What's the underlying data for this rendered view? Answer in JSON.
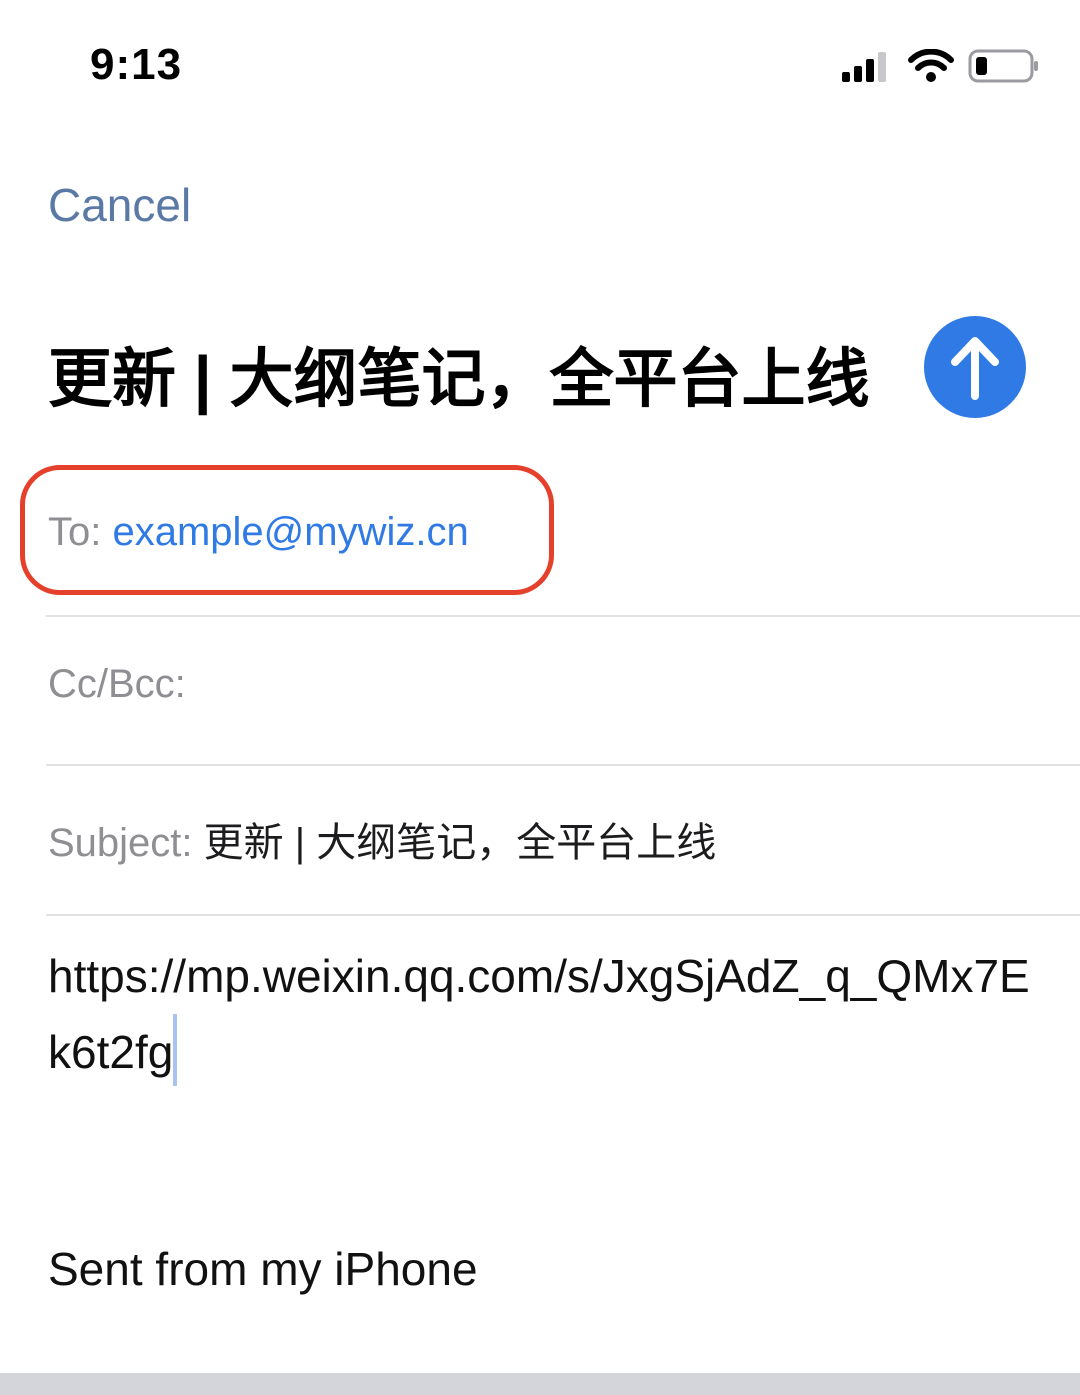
{
  "status_bar": {
    "time": "9:13",
    "icons": [
      "cellular-signal-icon",
      "wifi-icon",
      "battery-icon"
    ],
    "battery_level": 0.2
  },
  "nav": {
    "cancel_label": "Cancel"
  },
  "compose": {
    "title": "更新 | 大纲笔记，全平台上线",
    "send_icon": "arrow-up-icon",
    "to_label": "To:",
    "to_value": "example@mywiz.cn",
    "cc_label": "Cc/Bcc:",
    "subject_label": "Subject:",
    "subject_value": "更新 | 大纲笔记，全平台上线",
    "body_text": "https://mp.weixin.qq.com/s/JxgSjAdZ_q_QMx7Ek6t2fg",
    "signature": "Sent from my iPhone"
  },
  "colors": {
    "accent": "#2f7ae5",
    "cancel": "#5a7aa5",
    "highlight": "#e4402b",
    "label_gray": "#8e8e93"
  }
}
